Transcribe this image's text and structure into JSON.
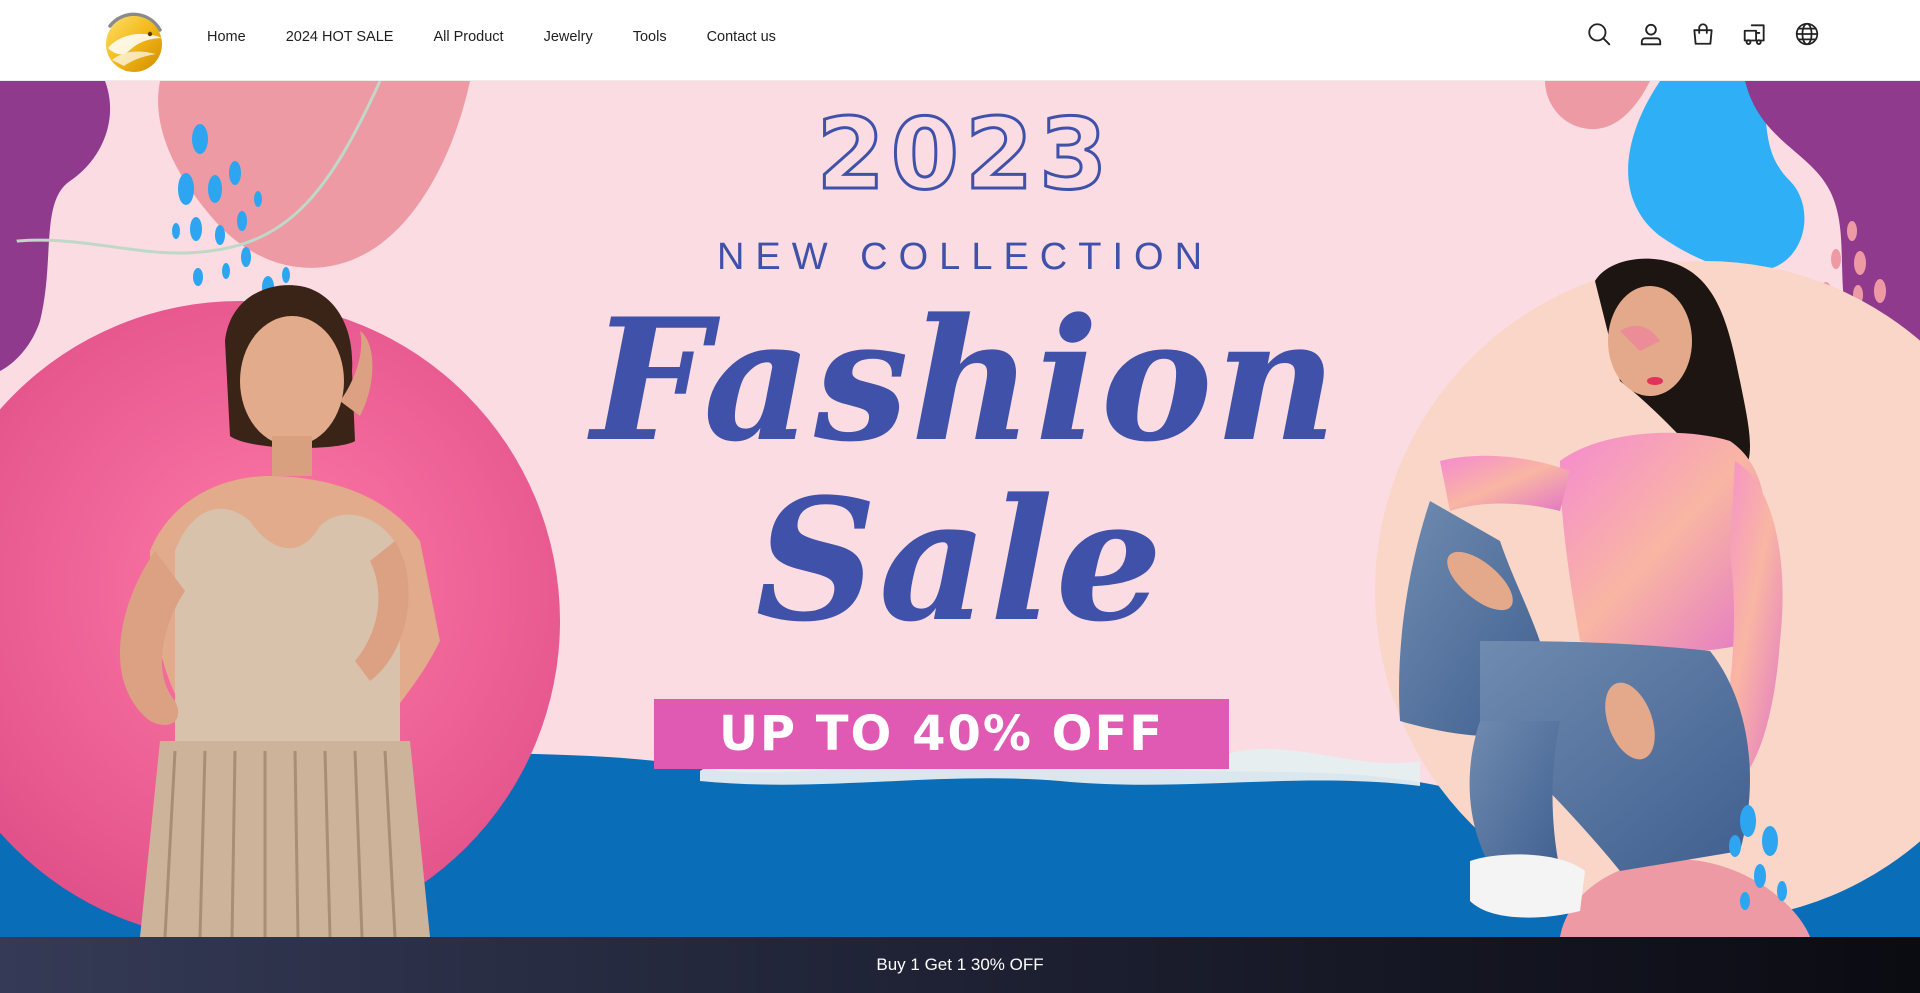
{
  "header": {
    "logo_name": "eagle-logo",
    "nav": [
      {
        "label": "Home"
      },
      {
        "label": "2024 HOT SALE"
      },
      {
        "label": "All Product"
      },
      {
        "label": "Jewelry"
      },
      {
        "label": "Tools"
      },
      {
        "label": "Contact us"
      }
    ],
    "icons": [
      "search-icon",
      "account-icon",
      "cart-icon",
      "order-tracking-icon",
      "language-icon"
    ]
  },
  "hero": {
    "year": "2023",
    "collection": "NEW COLLECTION",
    "title_line1": "Fashion",
    "title_line2": "Sale",
    "offer": "UP TO 40% OFF",
    "colors": {
      "background": "#fcdce3",
      "text": "#3f51a8",
      "offer_bg": "#e05ab4",
      "blue": "#0a6db8",
      "purple": "#8f3a8c",
      "pink": "#f2648f"
    }
  },
  "announcement": {
    "text": "Buy 1 Get 1 30% OFF"
  }
}
